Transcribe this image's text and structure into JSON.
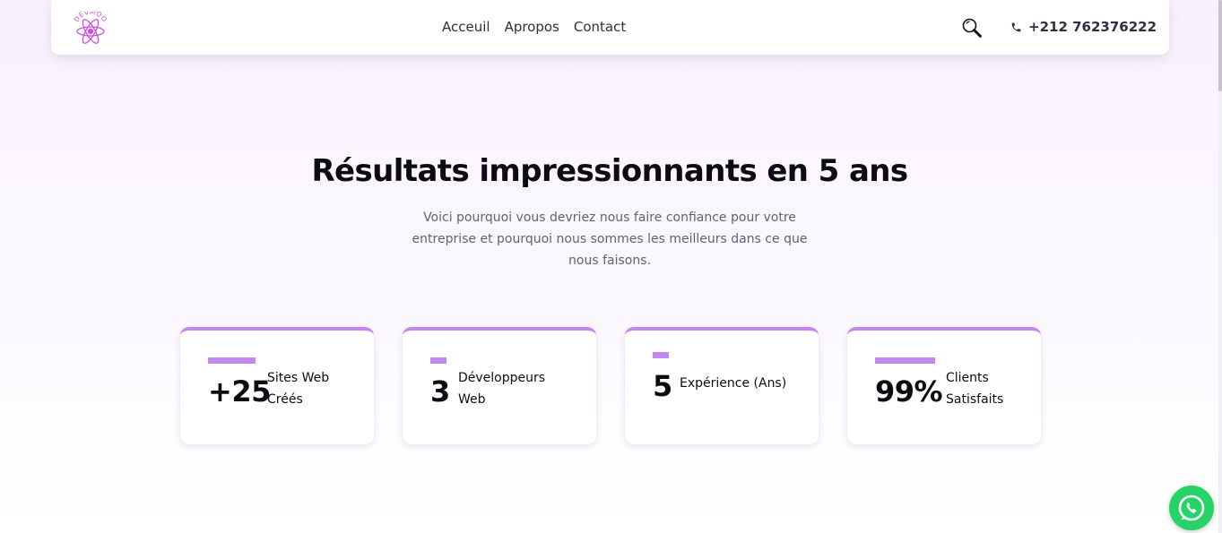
{
  "brand": {
    "logo_text": "DEVMOO",
    "logo_icon": "atom-icon"
  },
  "nav": {
    "links": [
      {
        "label": "Acceuil"
      },
      {
        "label": "Apropos"
      },
      {
        "label": "Contact"
      }
    ],
    "search_icon": "search-icon",
    "phone": {
      "icon": "phone-icon",
      "number": "+212 762376222"
    }
  },
  "section": {
    "title": "Résultats impressionnants en 5 ans",
    "description": "Voici pourquoi vous devriez nous faire confiance pour votre entreprise et pourquoi nous sommes les meilleurs dans ce que nous faisons."
  },
  "stats": [
    {
      "value": "+25",
      "label_line1": "Sites Web",
      "label_line2": "Créés"
    },
    {
      "value": "3",
      "label_line1": "Développeurs",
      "label_line2": "Web"
    },
    {
      "value": "5",
      "label_line1": "Expérience (Ans)",
      "label_line2": ""
    },
    {
      "value": "99%",
      "label_line1": "Clients",
      "label_line2": "Satisfaits"
    }
  ],
  "floating": {
    "whatsapp_icon": "whatsapp-icon"
  },
  "colors": {
    "accent": "#c387ef",
    "logo": "#d04fd8",
    "whatsapp": "#25d366",
    "text_dark": "#0c0c12",
    "text_muted": "#5f6472"
  }
}
